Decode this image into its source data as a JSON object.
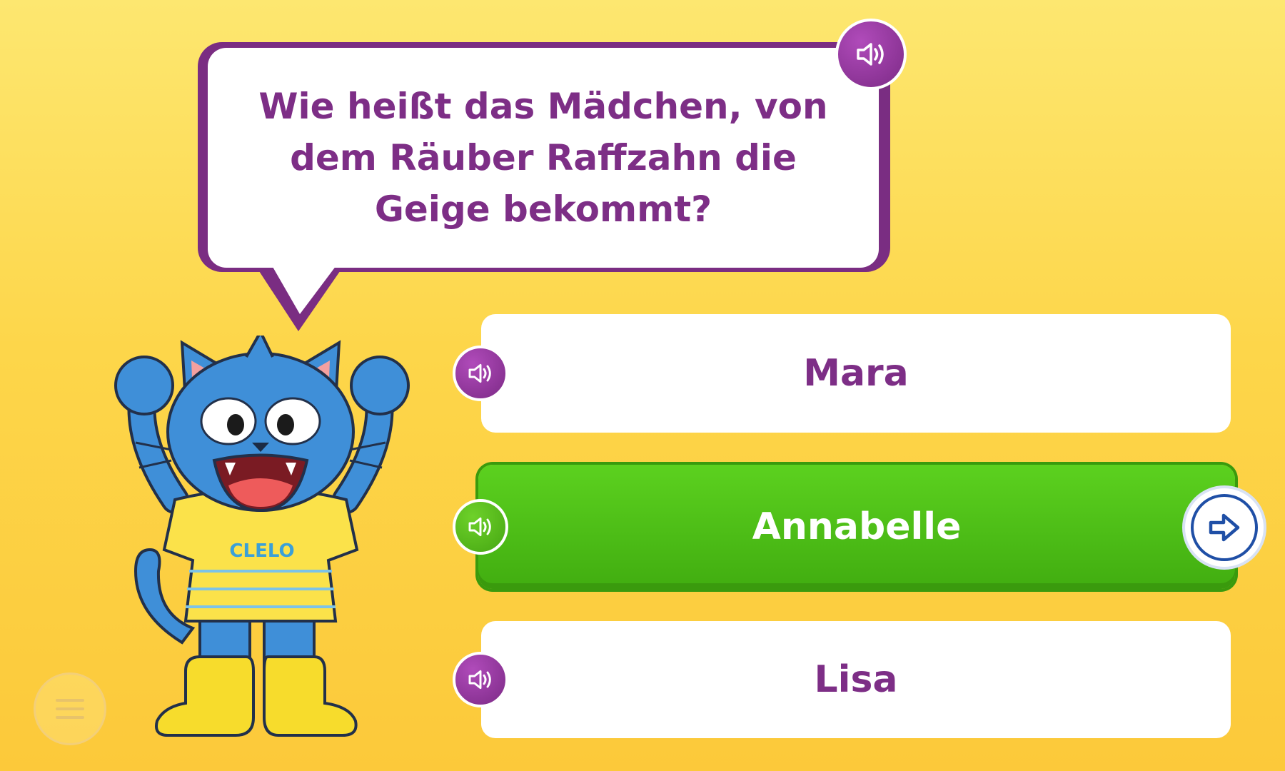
{
  "question": {
    "text": "Wie heißt das Mädchen, von dem Räuber Raffzahn die Geige bekommt?",
    "sound_icon": "speaker-icon"
  },
  "mascot": {
    "shirt_text": "CLELO"
  },
  "answers": [
    {
      "label": "Mara",
      "state": "default"
    },
    {
      "label": "Annabelle",
      "state": "selected"
    },
    {
      "label": "Lisa",
      "state": "default"
    }
  ],
  "controls": {
    "next_icon": "arrow-right-icon",
    "menu_icon": "hamburger-menu-icon"
  },
  "colors": {
    "accent_purple": "#7d2e86",
    "selected_green": "#4cbf16",
    "background_yellow": "#fdd64a",
    "next_blue": "#1f4fa6"
  }
}
